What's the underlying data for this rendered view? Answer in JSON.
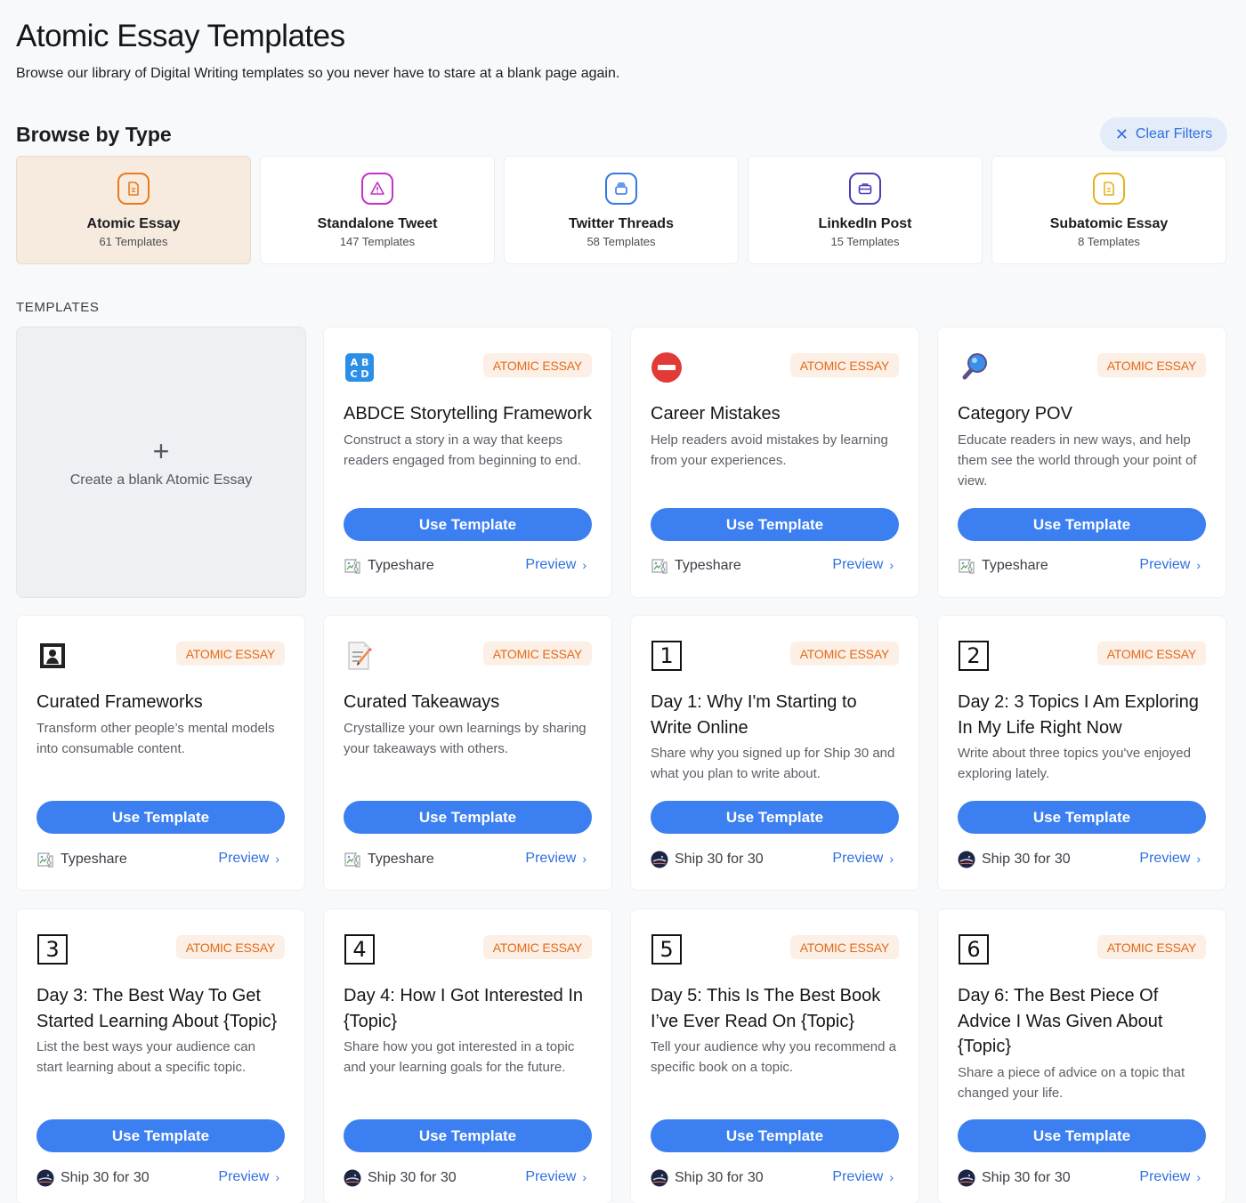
{
  "header": {
    "title": "Atomic Essay Templates",
    "subtitle": "Browse our library of Digital Writing templates so you never have to stare at a blank page again."
  },
  "browse": {
    "title": "Browse by Type",
    "clear_filters": "Clear Filters",
    "types": [
      {
        "name": "Atomic Essay",
        "count": "61 Templates",
        "icon": "document-icon",
        "color": "#e97a1e",
        "active": true
      },
      {
        "name": "Standalone Tweet",
        "count": "147 Templates",
        "icon": "warning-triangle-icon",
        "color": "#c531c9",
        "active": false
      },
      {
        "name": "Twitter Threads",
        "count": "58 Templates",
        "icon": "stack-icon",
        "color": "#3478e6",
        "active": false
      },
      {
        "name": "LinkedIn Post",
        "count": "15 Templates",
        "icon": "briefcase-icon",
        "color": "#4a3fb8",
        "active": false
      },
      {
        "name": "Subatomic Essay",
        "count": "8 Templates",
        "icon": "document-icon",
        "color": "#e6b21c",
        "active": false
      }
    ]
  },
  "templates_label": "TEMPLATES",
  "blank": {
    "plus": "+",
    "label": "Create a blank Atomic Essay"
  },
  "cards": [
    {
      "icon": "abcd-icon",
      "badge": "ATOMIC ESSAY",
      "title": "ABDCE Storytelling Framework",
      "desc": "Construct a story in a way that keeps readers engaged from beginning to end.",
      "use": "Use Template",
      "author": "Typeshare",
      "author_icon": "broken-image-icon",
      "preview": "Preview"
    },
    {
      "icon": "no-entry-icon",
      "badge": "ATOMIC ESSAY",
      "title": "Career Mistakes",
      "desc": "Help readers avoid mistakes by learning from your experiences.",
      "use": "Use Template",
      "author": "Typeshare",
      "author_icon": "broken-image-icon",
      "preview": "Preview"
    },
    {
      "icon": "magnifying-glass-icon",
      "badge": "ATOMIC ESSAY",
      "title": "Category POV",
      "desc": "Educate readers in new ways, and help them see the world through your point of view.",
      "use": "Use Template",
      "author": "Typeshare",
      "author_icon": "broken-image-icon",
      "preview": "Preview"
    },
    {
      "icon": "framed-picture-icon",
      "badge": "ATOMIC ESSAY",
      "title": "Curated Frameworks",
      "desc": "Transform other people’s mental models into consumable content.",
      "use": "Use Template",
      "author": "Typeshare",
      "author_icon": "broken-image-icon",
      "preview": "Preview"
    },
    {
      "icon": "memo-icon",
      "badge": "ATOMIC ESSAY",
      "title": "Curated Takeaways",
      "desc": "Crystallize your own learnings by sharing your takeaways with others.",
      "use": "Use Template",
      "author": "Typeshare",
      "author_icon": "broken-image-icon",
      "preview": "Preview"
    },
    {
      "icon": "number-icon",
      "num": "1",
      "badge": "ATOMIC ESSAY",
      "title": "Day 1: Why I'm Starting to Write Online",
      "desc": "Share why you signed up for Ship 30 and what you plan to write about.",
      "use": "Use Template",
      "author": "Ship 30 for 30",
      "author_icon": "ship30-avatar-icon",
      "preview": "Preview"
    },
    {
      "icon": "number-icon",
      "num": "2",
      "badge": "ATOMIC ESSAY",
      "title": "Day 2: 3 Topics I Am Exploring In My Life Right Now",
      "desc": "Write about three topics you've enjoyed exploring lately.",
      "use": "Use Template",
      "author": "Ship 30 for 30",
      "author_icon": "ship30-avatar-icon",
      "preview": "Preview"
    },
    {
      "icon": "number-icon",
      "num": "3",
      "badge": "ATOMIC ESSAY",
      "title": "Day 3: The Best Way To Get Started Learning About {Topic}",
      "desc": "List the best ways your audience can start learning about a specific topic.",
      "use": "Use Template",
      "author": "Ship 30 for 30",
      "author_icon": "ship30-avatar-icon",
      "preview": "Preview"
    },
    {
      "icon": "number-icon",
      "num": "4",
      "badge": "ATOMIC ESSAY",
      "title": "Day 4: How I Got Interested In {Topic}",
      "desc": "Share how you got interested in a topic and your learning goals for the future.",
      "use": "Use Template",
      "author": "Ship 30 for 30",
      "author_icon": "ship30-avatar-icon",
      "preview": "Preview"
    },
    {
      "icon": "number-icon",
      "num": "5",
      "badge": "ATOMIC ESSAY",
      "title": "Day 5: This Is The Best Book I’ve Ever Read On {Topic}",
      "desc": "Tell your audience why you recommend a specific book on a topic.",
      "use": "Use Template",
      "author": "Ship 30 for 30",
      "author_icon": "ship30-avatar-icon",
      "preview": "Preview"
    },
    {
      "icon": "number-icon",
      "num": "6",
      "badge": "ATOMIC ESSAY",
      "title": "Day 6: The Best Piece Of Advice I Was Given About {Topic}",
      "desc": "Share a piece of advice on a topic that changed your life.",
      "use": "Use Template",
      "author": "Ship 30 for 30",
      "author_icon": "ship30-avatar-icon",
      "preview": "Preview"
    }
  ]
}
